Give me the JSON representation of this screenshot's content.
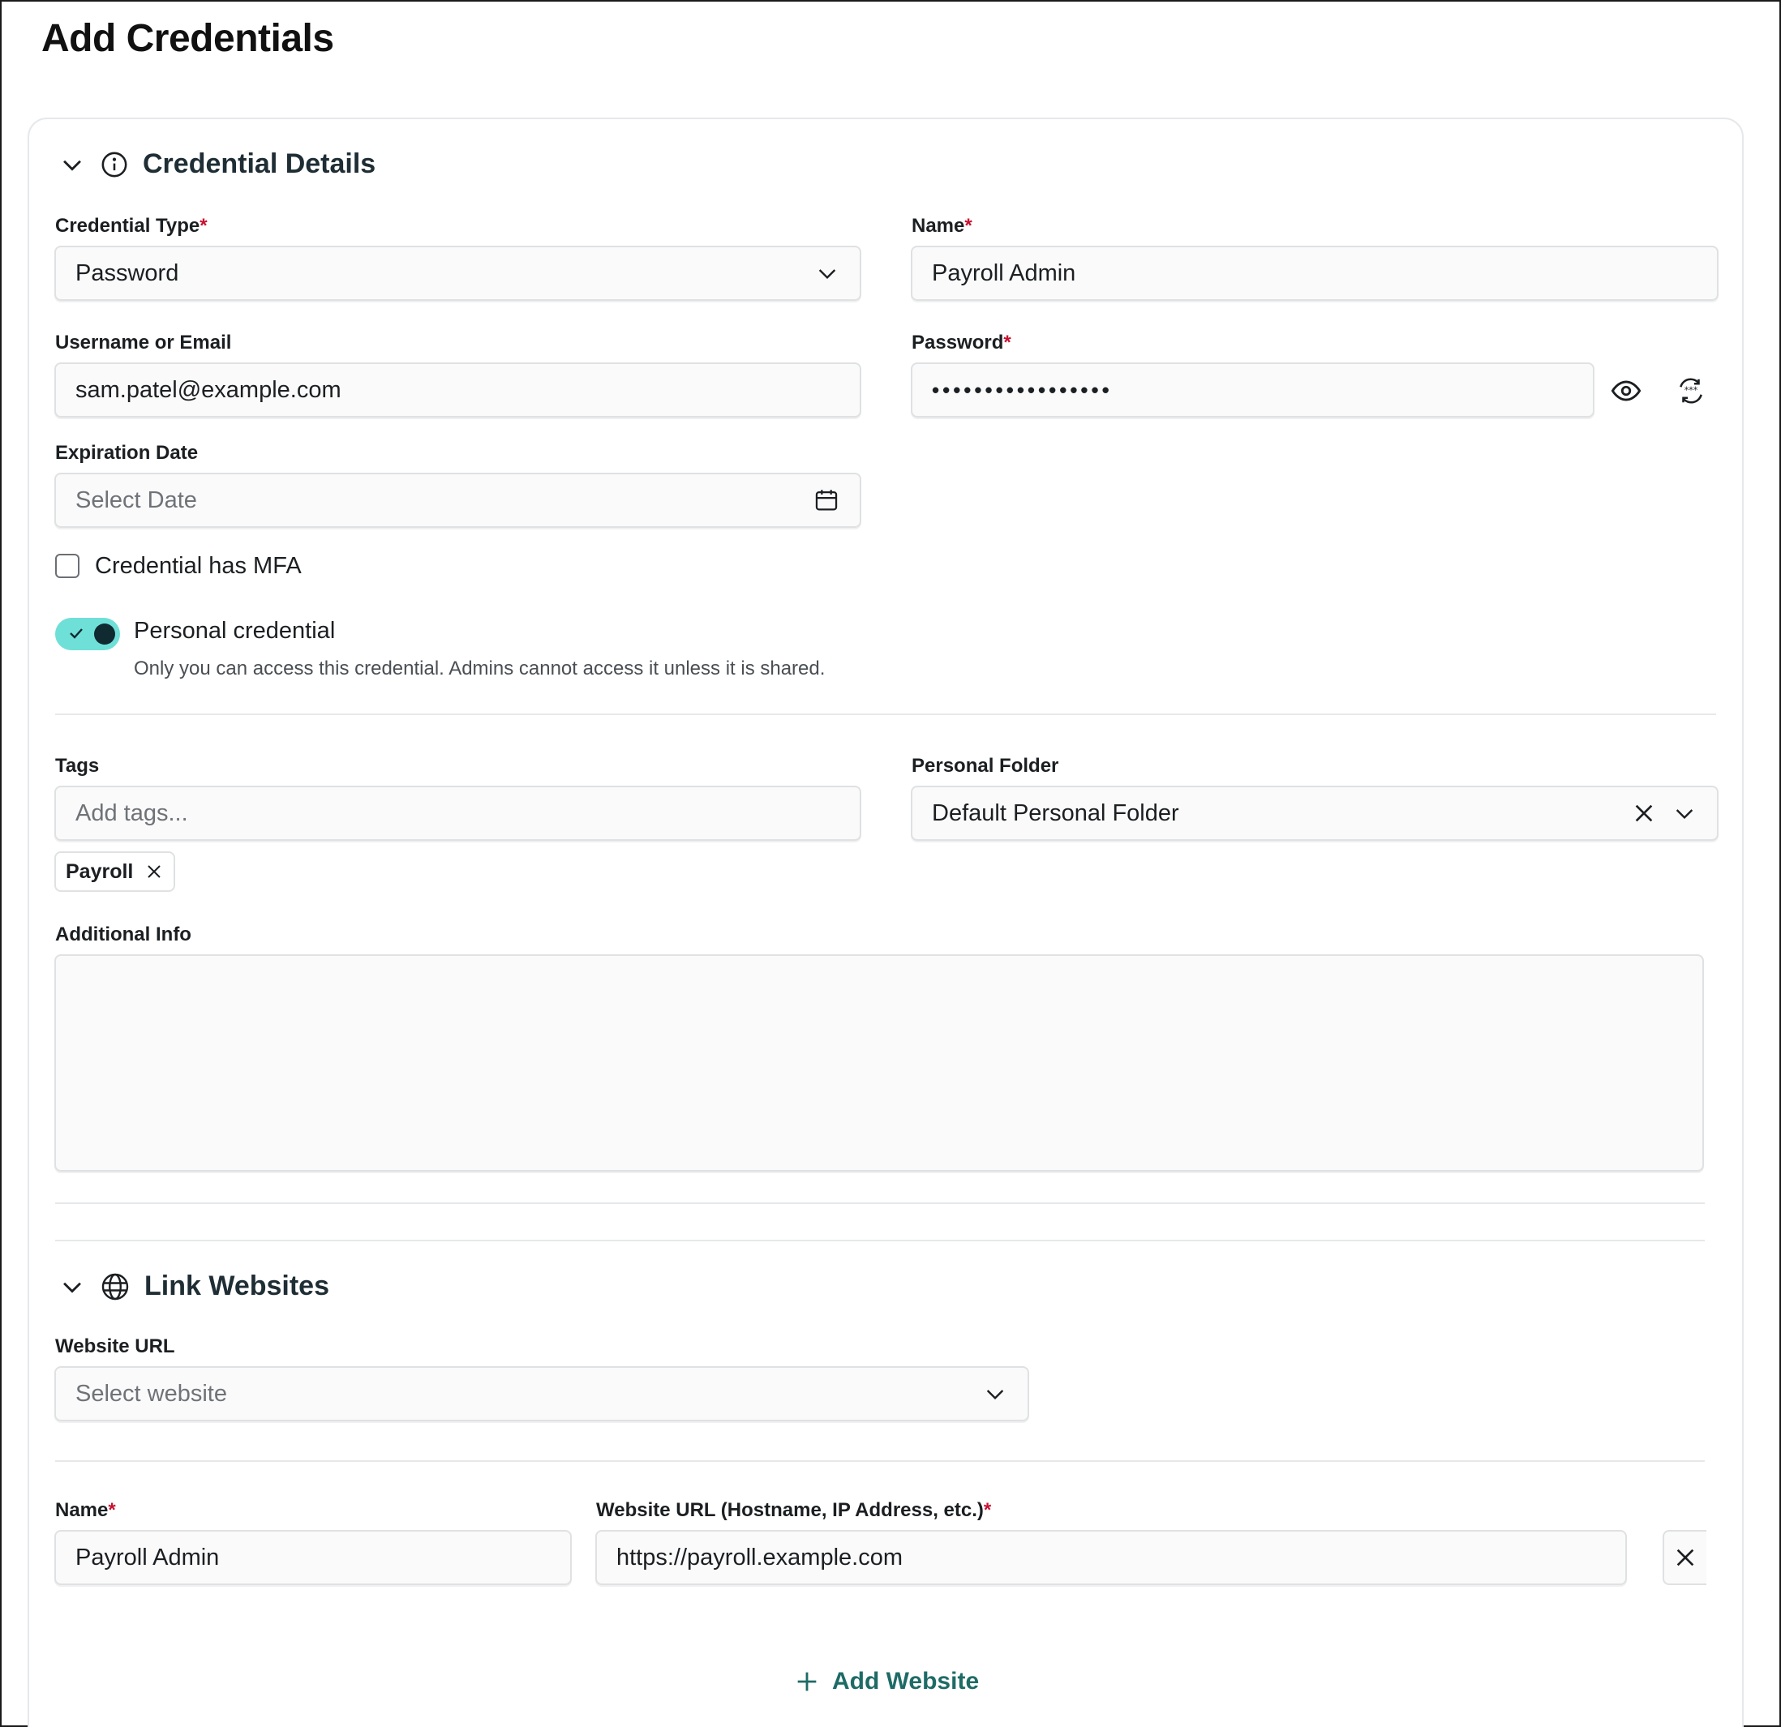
{
  "page": {
    "title": "Add Credentials"
  },
  "credential_details": {
    "section_title": "Credential Details",
    "credential_type": {
      "label": "Credential Type",
      "required_mark": "*",
      "value": "Password"
    },
    "name": {
      "label": "Name",
      "required_mark": "*",
      "value": "Payroll Admin"
    },
    "username": {
      "label": "Username or Email",
      "value": "sam.patel@example.com"
    },
    "password": {
      "label": "Password",
      "required_mark": "*",
      "masked_value": "•••••••••••••••••"
    },
    "expiration": {
      "label": "Expiration Date",
      "placeholder": "Select Date"
    },
    "mfa": {
      "label": "Credential has MFA",
      "checked": false
    },
    "personal": {
      "label": "Personal credential",
      "helper": "Only you can access this credential. Admins cannot access it unless it is shared.",
      "enabled": true
    },
    "tags": {
      "label": "Tags",
      "placeholder": "Add tags...",
      "items": [
        "Payroll"
      ]
    },
    "folder": {
      "label": "Personal Folder",
      "value": "Default Personal Folder"
    },
    "additional_info": {
      "label": "Additional Info",
      "value": ""
    }
  },
  "link_websites": {
    "section_title": "Link Websites",
    "website_url": {
      "label": "Website URL",
      "placeholder": "Select website"
    },
    "entry": {
      "name_label": "Name",
      "name_required": "*",
      "name_value": "Payroll Admin",
      "url_label": "Website URL (Hostname, IP Address, etc.)",
      "url_required": "*",
      "url_value": "https://payroll.example.com"
    },
    "add_label": "Add Website"
  },
  "colors": {
    "accent": "#1e6b66",
    "toggle_on": "#6ee0d8",
    "required": "#c8102e"
  },
  "icons": [
    "chevron-down-icon",
    "info-icon",
    "globe-icon",
    "eye-icon",
    "regenerate-password-icon",
    "calendar-icon",
    "close-icon",
    "check-icon",
    "plus-icon"
  ]
}
